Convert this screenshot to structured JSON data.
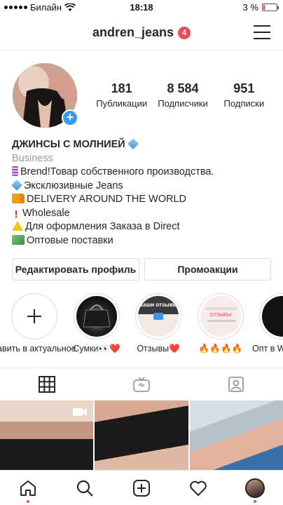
{
  "status_bar": {
    "carrier": "Билайн",
    "time": "18:18",
    "battery": "3 %"
  },
  "header": {
    "username": "andren_jeans",
    "notification_count": "4"
  },
  "profile": {
    "stats": [
      {
        "value": "181",
        "label": "Публикации"
      },
      {
        "value": "8 584",
        "label": "Подписчики"
      },
      {
        "value": "951",
        "label": "Подписки"
      }
    ],
    "name": "ДЖИНСЫ С МОЛНИЕЙ",
    "category": "Business",
    "bio_lines": [
      {
        "icon": "zipper-icon",
        "text": "Brend!Товар собственного производства."
      },
      {
        "icon": "diamond-icon",
        "text": "Эксклюзивные Jeans"
      },
      {
        "icon": "truck-icon",
        "text": "DELIVERY AROUND THE WORLD"
      },
      {
        "icon": "exclamation-icon",
        "text": "Wholesale"
      },
      {
        "icon": "warning-icon",
        "text": "Для оформления Заказа в Direct"
      },
      {
        "icon": "money-icon",
        "text": "Оптовые поставки"
      }
    ]
  },
  "buttons": {
    "edit_profile": "Редактировать профиль",
    "promotions": "Промоакции"
  },
  "highlights": [
    {
      "label": "авить в актуальное",
      "kind": "add"
    },
    {
      "label": "Сумки👀❤️",
      "kind": "bags"
    },
    {
      "label": "Отзывы❤️",
      "kind": "reviews"
    },
    {
      "label": "🔥🔥🔥🔥",
      "kind": "fire"
    },
    {
      "label": "Опт в W",
      "kind": "opt"
    }
  ],
  "highlight_overlay_text": {
    "reviews": "Ваши отзывы",
    "fire": "ОТЗЫВЫ"
  },
  "colors": {
    "accent_blue": "#3897f0",
    "badge_red": "#ed4956",
    "divider": "#e6e6e6"
  }
}
